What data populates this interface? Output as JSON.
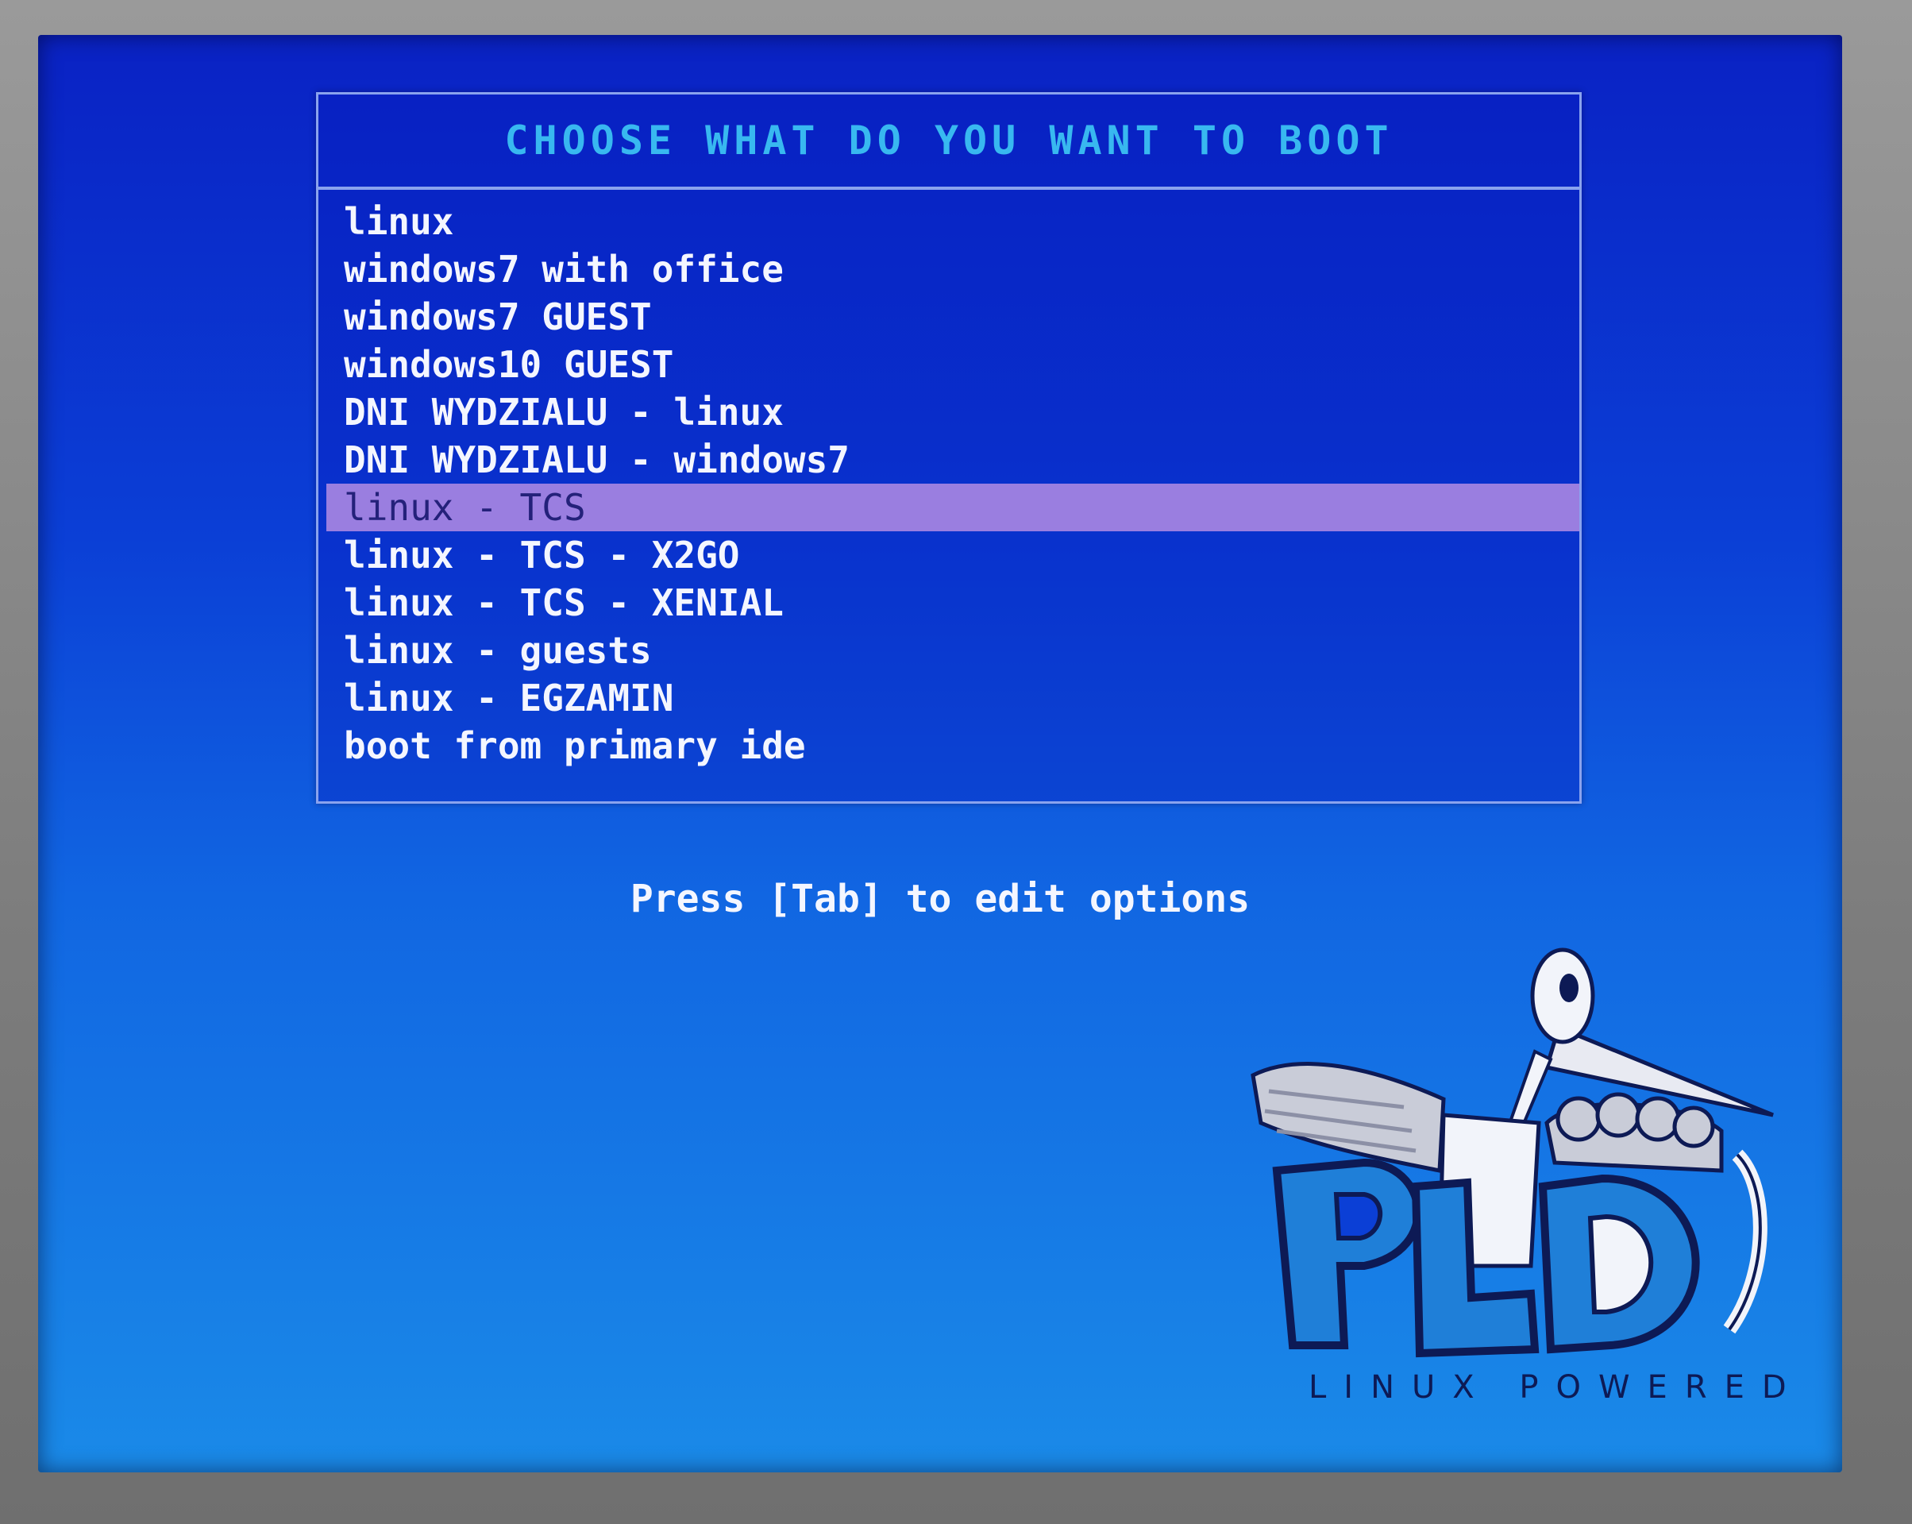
{
  "boot_menu": {
    "title": "CHOOSE WHAT DO YOU WANT TO BOOT",
    "items": [
      {
        "label": "linux",
        "selected": false
      },
      {
        "label": "windows7 with office",
        "selected": false
      },
      {
        "label": "windows7 GUEST",
        "selected": false
      },
      {
        "label": "windows10 GUEST",
        "selected": false
      },
      {
        "label": "DNI WYDZIALU - linux",
        "selected": false
      },
      {
        "label": "DNI WYDZIALU - windows7",
        "selected": false
      },
      {
        "label": "linux - TCS",
        "selected": true
      },
      {
        "label": "linux - TCS - X2GO",
        "selected": false
      },
      {
        "label": "linux - TCS - XENIAL",
        "selected": false
      },
      {
        "label": "linux - guests",
        "selected": false
      },
      {
        "label": "linux - EGZAMIN",
        "selected": false
      },
      {
        "label": "boot from primary ide",
        "selected": false
      }
    ],
    "hint": "Press [Tab] to edit options"
  },
  "logo": {
    "text": "PLD",
    "caption": "LINUX POWERED",
    "icon": "pld-bird-logo"
  },
  "colors": {
    "background_top": "#0a22c4",
    "background_bottom": "#1a8ae8",
    "title": "#38b8f0",
    "item_text": "#f4f6ff",
    "selected_bar": "#9a7ee0",
    "selected_text": "#24217a",
    "border": "#8aa3ee"
  }
}
